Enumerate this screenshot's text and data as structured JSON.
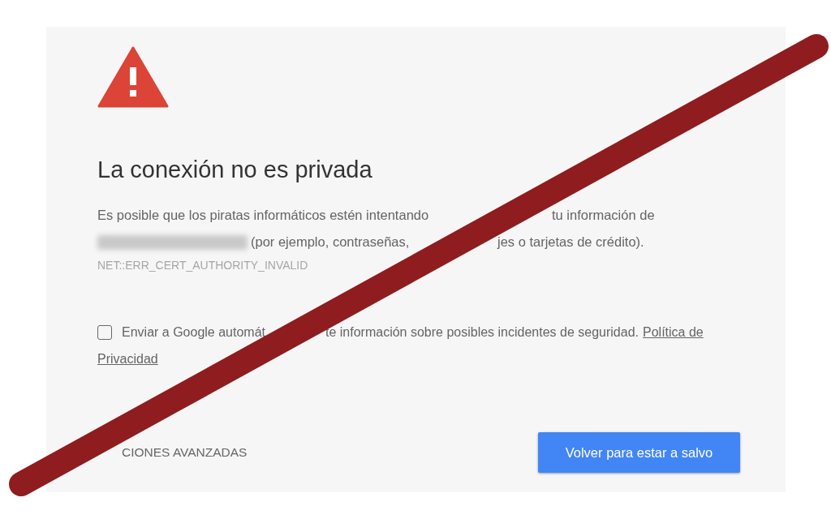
{
  "title": "La conexión no es privada",
  "message": {
    "line_1": {
      "before": "Es posible que los piratas informáticos estén intentando",
      "after": "tu información de"
    },
    "line_2": {
      "before": "(por ejemplo, contraseñas,",
      "after": "jes o tarjetas de crédito)."
    }
  },
  "error_code": "NET::ERR_CERT_AUTHORITY_INVALID",
  "report": {
    "checked": false,
    "before": "Enviar a Google automát",
    "after": "te información sobre posibles incidentes de seguridad.",
    "link_line_1": "Política de",
    "link_line_2": "Privacidad"
  },
  "advanced_link": "CIONES AVANZADAS",
  "primary_button": "Volver para estar a salvo"
}
